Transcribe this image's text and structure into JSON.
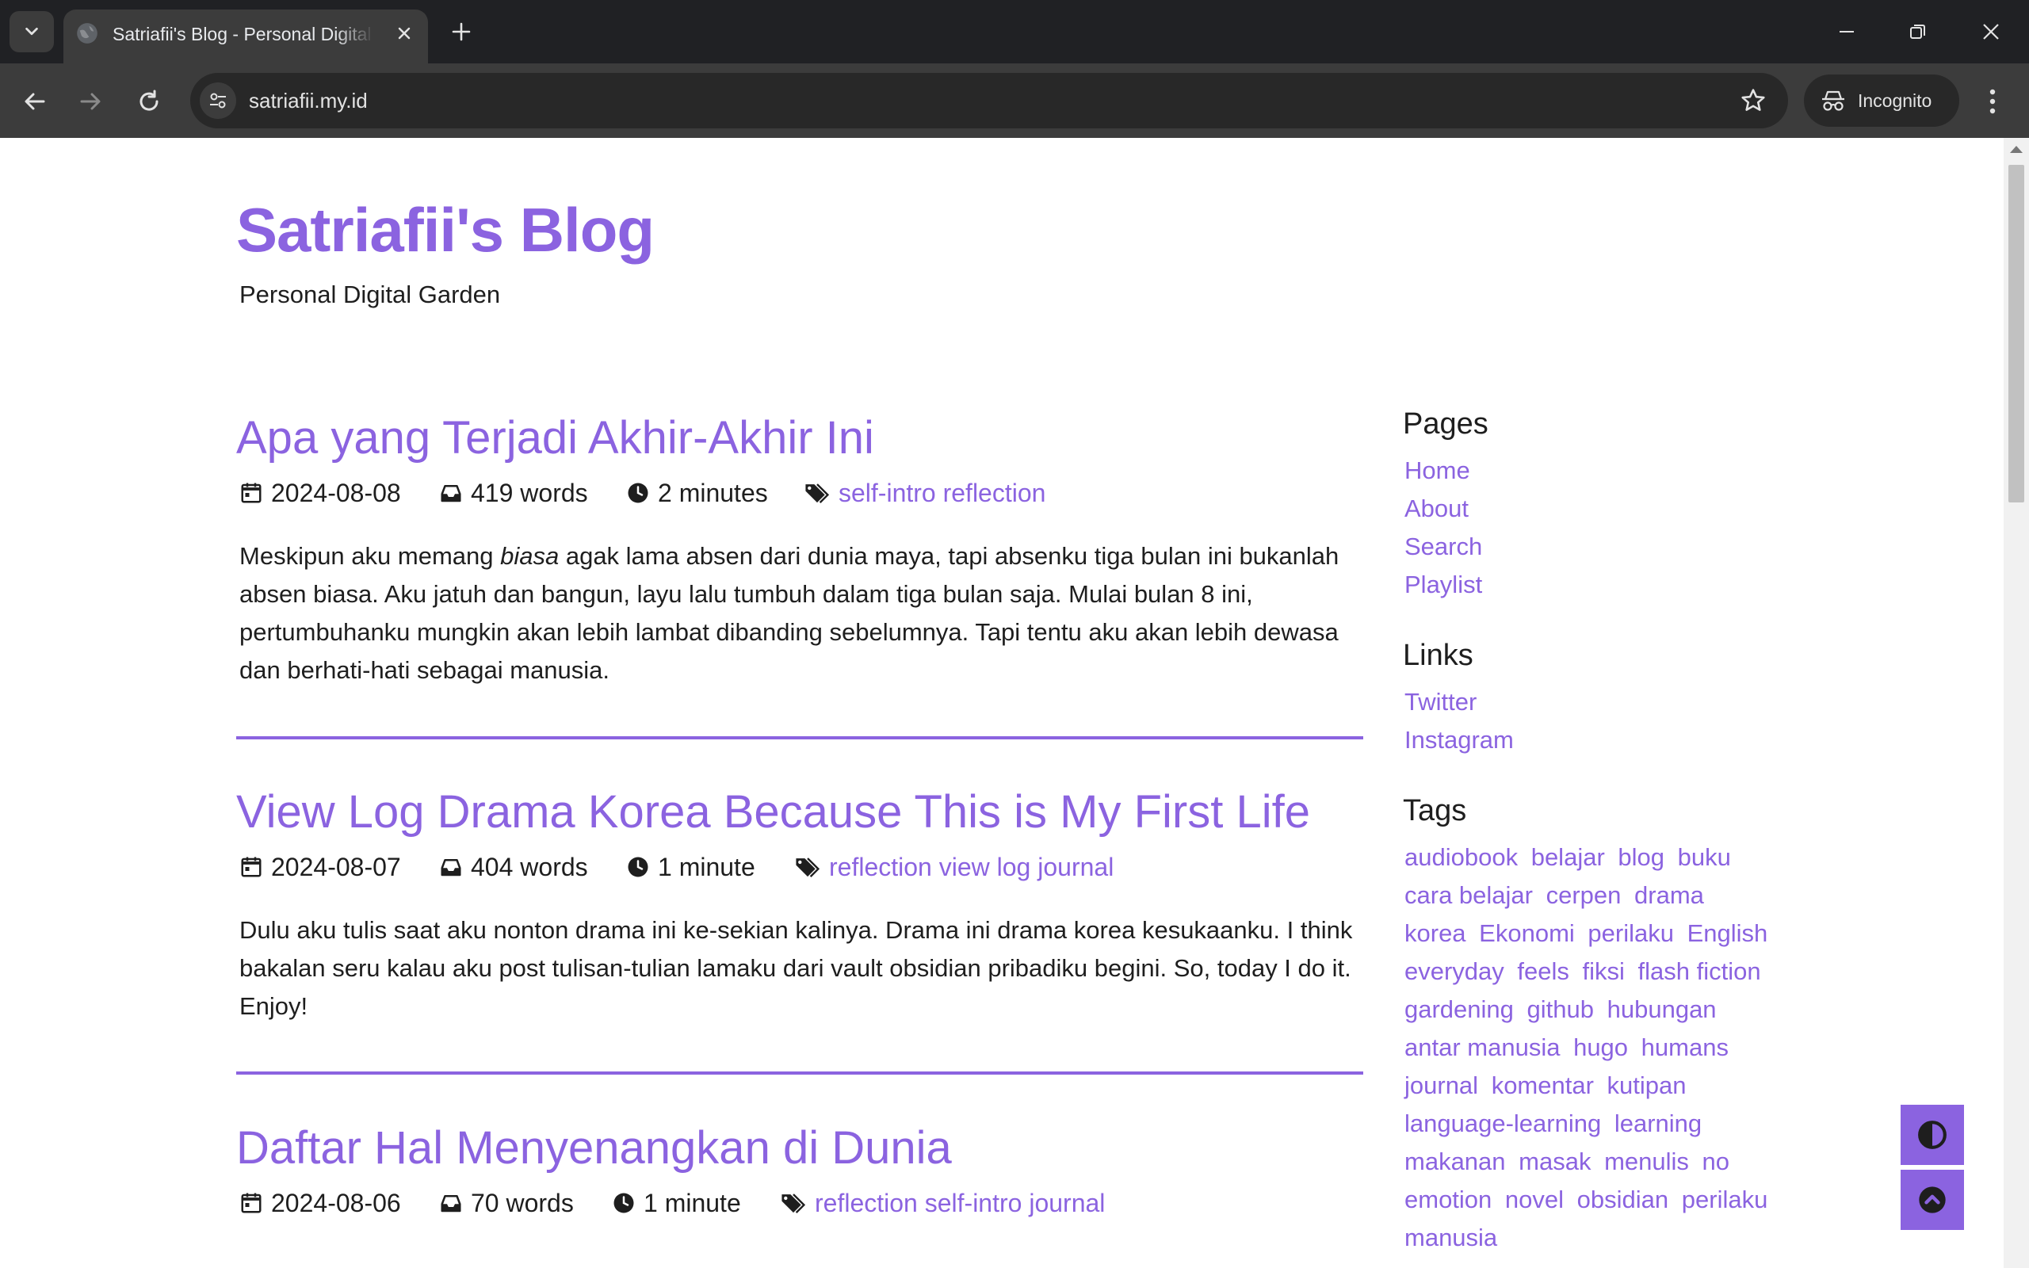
{
  "browser": {
    "tab_title": "Satriafii's Blog - Personal Digital Garden",
    "url": "satriafii.my.id",
    "incognito_label": "Incognito"
  },
  "site": {
    "title": "Satriafii's Blog",
    "subtitle": "Personal Digital Garden"
  },
  "posts": [
    {
      "title": "Apa yang Terjadi Akhir-Akhir Ini",
      "date": "2024-08-08",
      "words": "419 words",
      "time": "2 minutes",
      "tags": "self-intro reflection",
      "excerpt_before": "Meskipun aku memang ",
      "excerpt_em": "biasa",
      "excerpt_after": " agak lama absen dari dunia maya, tapi absenku tiga bulan ini bukanlah absen biasa. Aku jatuh dan bangun, layu lalu tumbuh dalam tiga bulan saja. Mulai bulan 8 ini, pertumbuhanku mungkin akan lebih lambat dibanding sebelumnya. Tapi tentu aku akan lebih dewasa dan berhati-hati sebagai manusia."
    },
    {
      "title": "View Log Drama Korea Because This is My First Life",
      "date": "2024-08-07",
      "words": "404 words",
      "time": "1 minute",
      "tags": "reflection view log journal",
      "excerpt": "Dulu aku tulis saat aku nonton drama ini ke-sekian kalinya. Drama ini drama korea kesukaanku. I think bakalan seru kalau aku post tulisan-tulian lamaku dari vault obsidian pribadiku begini. So, today I do it. Enjoy!"
    },
    {
      "title": "Daftar Hal Menyenangkan di Dunia",
      "date": "2024-08-06",
      "words": "70 words",
      "time": "1 minute",
      "tags": "reflection self-intro journal"
    }
  ],
  "sidebar": {
    "pages_heading": "Pages",
    "pages": [
      "Home",
      "About",
      "Search",
      "Playlist"
    ],
    "links_heading": "Links",
    "links": [
      "Twitter",
      "Instagram"
    ],
    "tags_heading": "Tags",
    "tags": [
      "audiobook",
      "belajar",
      "blog",
      "buku",
      "cara belajar",
      "cerpen",
      "drama korea",
      "Ekonomi",
      "perilaku",
      "English everyday",
      "feels",
      "fiksi",
      "flash fiction",
      "gardening",
      "github",
      "hubungan antar manusia",
      "hugo",
      "humans",
      "journal",
      "komentar",
      "kutipan",
      "language-learning",
      "learning",
      "makanan",
      "masak",
      "menulis",
      "no emotion",
      "novel",
      "obsidian",
      "perilaku manusia"
    ]
  },
  "colors": {
    "accent": "#8b63e0",
    "text": "#1e1e1e",
    "chrome_dark": "#202124",
    "chrome_toolbar": "#3c3c3c"
  },
  "icons": {
    "theme_toggle": "contrast-icon",
    "back_to_top": "arrow-up-circle-icon"
  }
}
